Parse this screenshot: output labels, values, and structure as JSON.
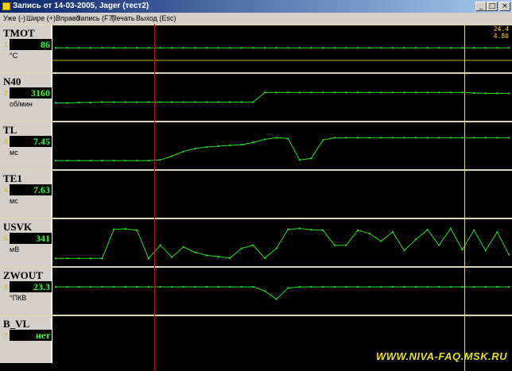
{
  "window": {
    "title": "Запись от 14-03-2005, Jager (тест2)",
    "buttons": {
      "minimize": "_",
      "maximize": "□",
      "close": "×"
    }
  },
  "menu": [
    "Уже (-)",
    "Шире (+)",
    "Вправо",
    "Запись (F7)",
    "Печать",
    "Выход (Esc)"
  ],
  "colors": {
    "trace": "#22e022",
    "cursor_red": "#c01010",
    "cursor_yellow": "#d8d860",
    "panel_divider": "#d9d5b8",
    "value_text": "#34ff34"
  },
  "cursor_readout": [
    "24.4",
    "4.80"
  ],
  "watermark": "WWW.NIVA-FAQ.MSK.RU",
  "panels": [
    {
      "id": "tmot",
      "name": "TMOT",
      "index": "1",
      "value": "86",
      "unit": "°C"
    },
    {
      "id": "n40",
      "name": "N40",
      "index": "2",
      "value": "3160",
      "unit": "об/мин"
    },
    {
      "id": "tl",
      "name": "TL",
      "index": "3",
      "value": "7.45",
      "unit": "мс"
    },
    {
      "id": "te1",
      "name": "TE1",
      "index": "4",
      "value": "7.63",
      "unit": "мс"
    },
    {
      "id": "usvk",
      "name": "USVK",
      "index": "5",
      "value": "341",
      "unit": "мВ"
    },
    {
      "id": "zwout",
      "name": "ZWOUT",
      "index": "6",
      "value": "23.3",
      "unit": "°ПКВ"
    },
    {
      "id": "b_vl",
      "name": "B_VL",
      "index": "7",
      "value": "нет",
      "unit": ""
    }
  ],
  "chart_data": {
    "type": "line",
    "x_samples": 40,
    "series": [
      {
        "name": "TMOT",
        "values": [
          86,
          86,
          86,
          86,
          86,
          86,
          86,
          86,
          86,
          86,
          86,
          86,
          86,
          86,
          86,
          86,
          86,
          86,
          86,
          86,
          86,
          86,
          86,
          86,
          86,
          86,
          86,
          86,
          86,
          86,
          86,
          86,
          86,
          86,
          86,
          86,
          86,
          86,
          86,
          86
        ]
      },
      {
        "name": "N40",
        "values": [
          3040,
          3040,
          3045,
          3045,
          3050,
          3050,
          3050,
          3050,
          3050,
          3050,
          3050,
          3050,
          3050,
          3050,
          3050,
          3050,
          3050,
          3050,
          3160,
          3160,
          3160,
          3160,
          3160,
          3160,
          3160,
          3160,
          3160,
          3160,
          3160,
          3160,
          3160,
          3160,
          3160,
          3160,
          3160,
          3160,
          3155,
          3150,
          3150,
          3150
        ]
      },
      {
        "name": "TL",
        "values": [
          2.6,
          2.6,
          2.6,
          2.6,
          2.6,
          2.6,
          2.6,
          2.6,
          2.6,
          2.7,
          3.2,
          3.8,
          4.2,
          4.4,
          4.5,
          4.6,
          4.7,
          5.0,
          5.4,
          5.6,
          5.5,
          2.7,
          2.9,
          5.3,
          5.6,
          5.6,
          5.6,
          5.6,
          5.6,
          5.6,
          5.6,
          5.6,
          5.6,
          5.6,
          5.6,
          5.6,
          5.6,
          5.6,
          5.6,
          5.6
        ]
      },
      {
        "name": "TE1",
        "values": []
      },
      {
        "name": "USVK",
        "values": [
          120,
          120,
          120,
          120,
          120,
          780,
          790,
          760,
          120,
          420,
          150,
          380,
          260,
          190,
          160,
          130,
          350,
          420,
          130,
          350,
          780,
          800,
          770,
          760,
          420,
          420,
          760,
          690,
          510,
          720,
          300,
          550,
          770,
          420,
          800,
          320,
          760,
          300,
          720,
          210
        ]
      },
      {
        "name": "ZWOUT",
        "values": [
          23.3,
          23.3,
          23.3,
          23.3,
          23.3,
          23.3,
          23.3,
          23.3,
          23.3,
          23.3,
          23.3,
          23.3,
          23.3,
          23.3,
          23.3,
          23.3,
          23.3,
          23.3,
          22.6,
          21.2,
          23.1,
          23.3,
          23.3,
          23.3,
          23.3,
          23.3,
          23.3,
          23.3,
          23.3,
          23.3,
          23.3,
          23.3,
          23.3,
          23.3,
          23.3,
          23.3,
          23.3,
          23.3,
          23.3,
          23.3
        ]
      },
      {
        "name": "B_VL",
        "values": []
      }
    ],
    "cursors": {
      "red_sample": 8.5,
      "yellow_sample": 35.2
    }
  }
}
